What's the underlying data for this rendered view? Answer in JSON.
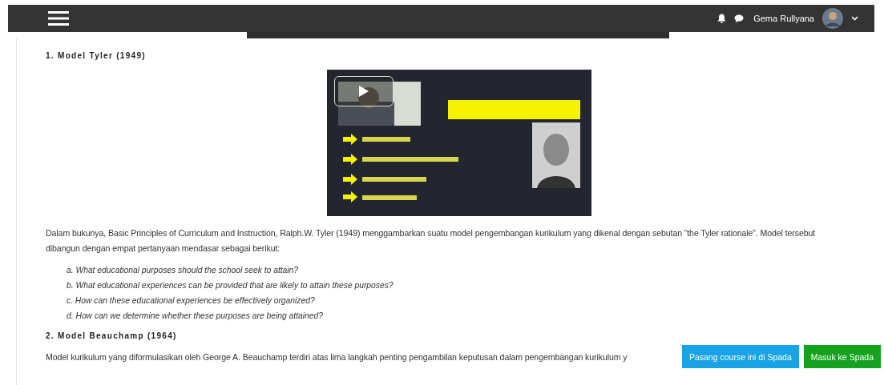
{
  "header": {
    "user_name": "Gema Rullyana"
  },
  "sections": [
    {
      "heading": "1. Model Tyler (1949)",
      "paragraph": "Dalam bukunya, Basic Principles of Curriculum and Instruction, Ralph.W. Tyler (1949) menggambarkan suatu model pengembangan kurikulum yang dikenal dengan sebutan “the Tyler rationale”. Model tersebut dibangun dengan empat pertanyaan mendasar sebagai berikut:",
      "questions": [
        "a. What educational purposes should the school seek to attain?",
        "b. What educational experiences can be provided that are likely to attain these purposes?",
        "c. How can these educational experiences be effectively organized?",
        "d. How can we determine whether these purposes are being attained?"
      ]
    },
    {
      "heading": "2. Model Beauchamp (1964)",
      "paragraph": "Model kurikulum yang diformulasikan oleh George A. Beauchamp terdiri atas lima langkah penting pengambilan keputusan dalam pengembangan kurikulum y"
    }
  ],
  "footer_buttons": [
    {
      "label": "Pasang course ini di Spada",
      "kind": "secondary"
    },
    {
      "label": "Masuk ke Spada",
      "kind": "primary"
    }
  ]
}
